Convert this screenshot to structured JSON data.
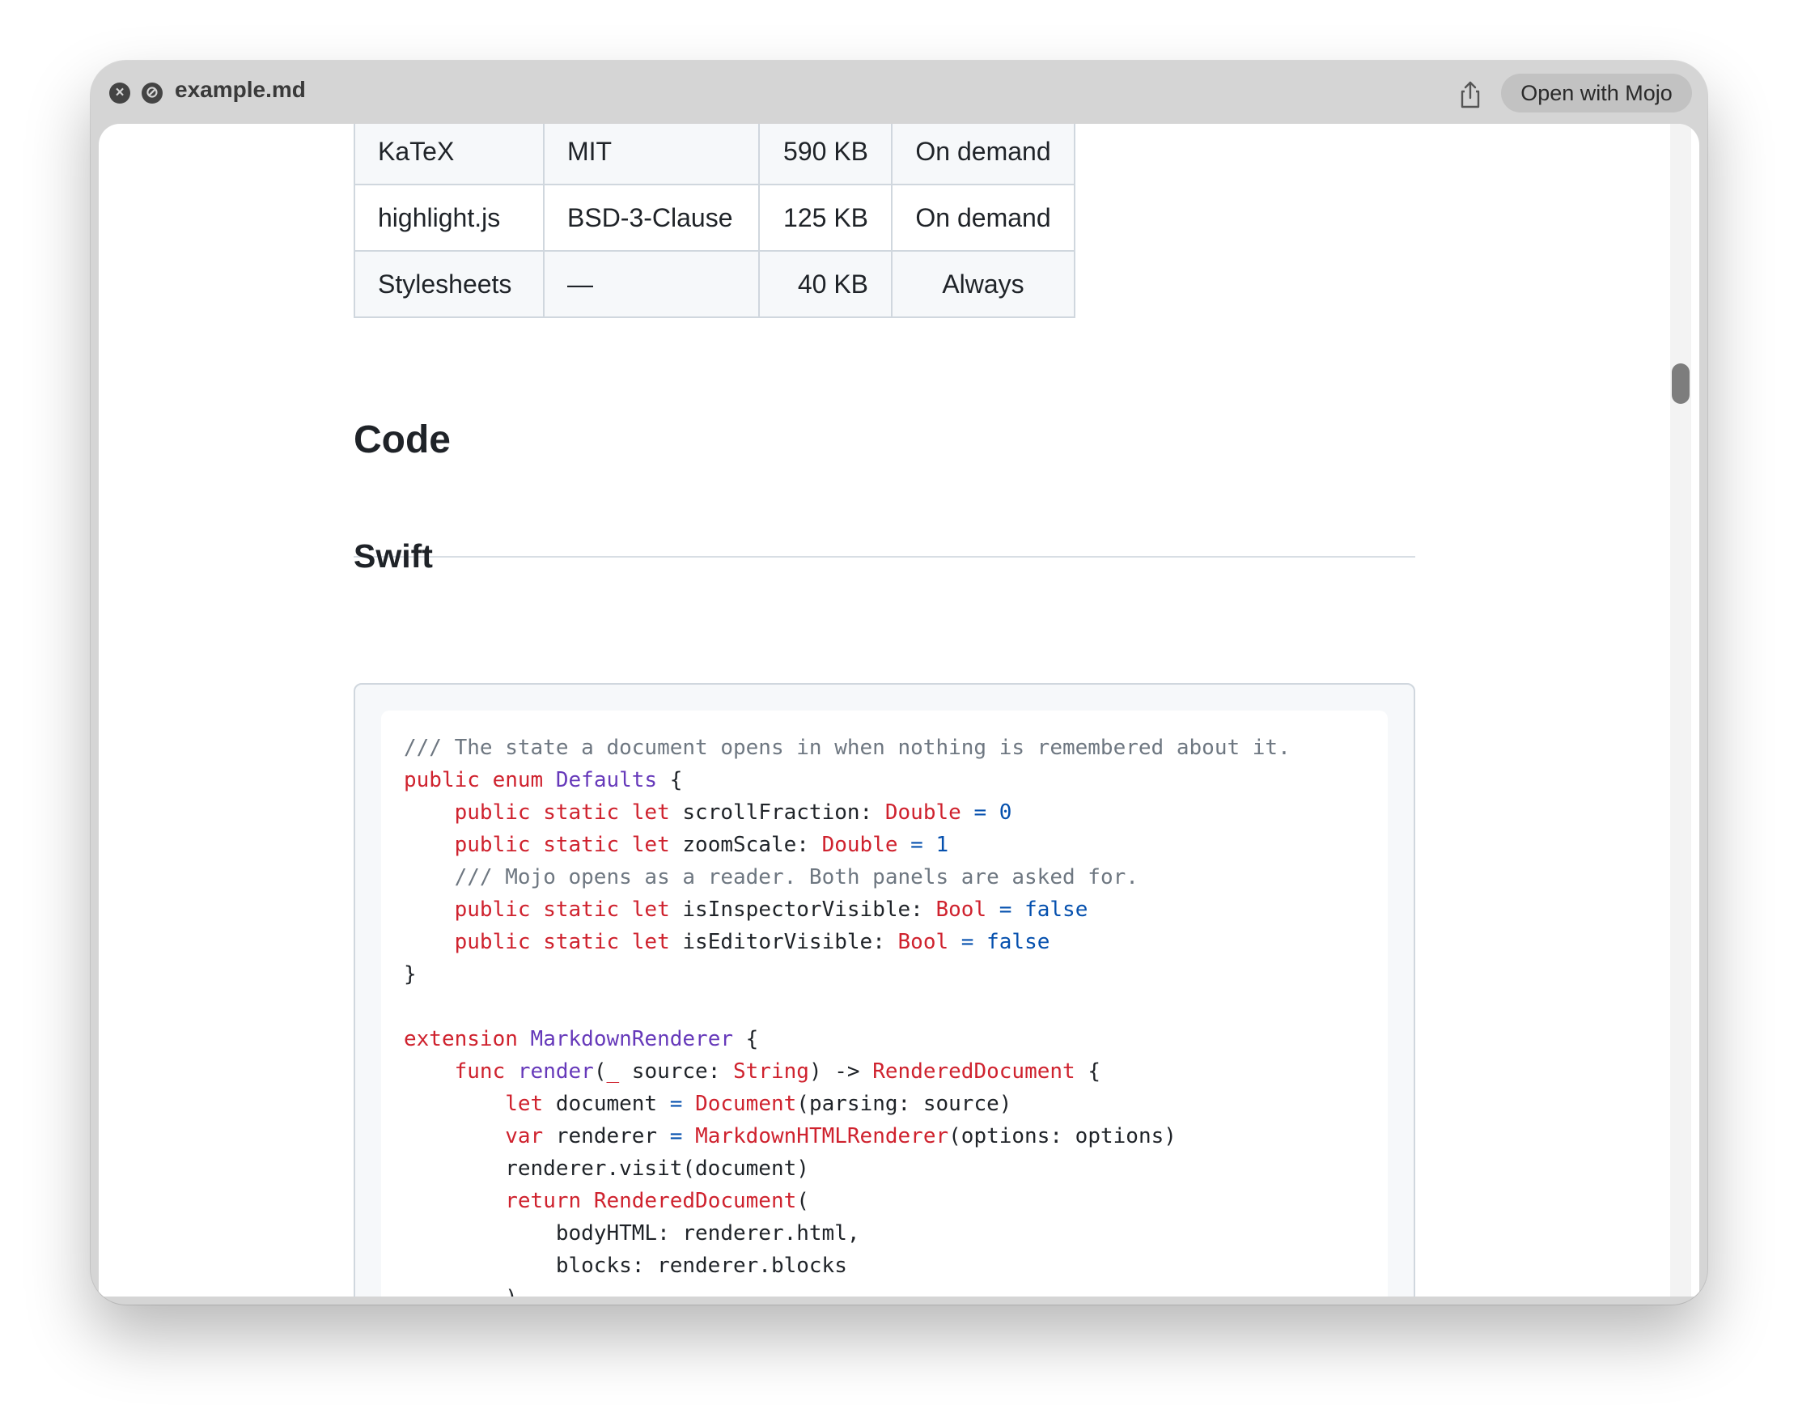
{
  "window": {
    "title": "example.md",
    "open_button_label": "Open with Mojo",
    "close_icon": "x-circle-icon",
    "block_icon": "no-entry-icon",
    "share_icon": "share-icon"
  },
  "table": {
    "rows": [
      {
        "name": "KaTeX",
        "license": "MIT",
        "size": "590 KB",
        "loading": "On demand"
      },
      {
        "name": "highlight.js",
        "license": "BSD-3-Clause",
        "size": "125 KB",
        "loading": "On demand"
      },
      {
        "name": "Stylesheets",
        "license": "—",
        "size": "40 KB",
        "loading": "Always"
      }
    ]
  },
  "headings": {
    "code": "Code",
    "swift": "Swift"
  },
  "code_lines": [
    [
      {
        "t": "/// The state a document opens in when nothing is remembered about it.",
        "c": "cm"
      }
    ],
    [
      {
        "t": "public",
        "c": "kw"
      },
      {
        "t": " ",
        "c": "pl"
      },
      {
        "t": "enum",
        "c": "kw"
      },
      {
        "t": " ",
        "c": "pl"
      },
      {
        "t": "Defaults",
        "c": "ty"
      },
      {
        "t": " {",
        "c": "pl"
      }
    ],
    [
      {
        "t": "    ",
        "c": "pl"
      },
      {
        "t": "public",
        "c": "kw"
      },
      {
        "t": " ",
        "c": "pl"
      },
      {
        "t": "static",
        "c": "kw"
      },
      {
        "t": " ",
        "c": "pl"
      },
      {
        "t": "let",
        "c": "kw"
      },
      {
        "t": " scrollFraction: ",
        "c": "pl"
      },
      {
        "t": "Double",
        "c": "kw"
      },
      {
        "t": " ",
        "c": "pl"
      },
      {
        "t": "=",
        "c": "nu"
      },
      {
        "t": " ",
        "c": "pl"
      },
      {
        "t": "0",
        "c": "nu"
      }
    ],
    [
      {
        "t": "    ",
        "c": "pl"
      },
      {
        "t": "public",
        "c": "kw"
      },
      {
        "t": " ",
        "c": "pl"
      },
      {
        "t": "static",
        "c": "kw"
      },
      {
        "t": " ",
        "c": "pl"
      },
      {
        "t": "let",
        "c": "kw"
      },
      {
        "t": " zoomScale: ",
        "c": "pl"
      },
      {
        "t": "Double",
        "c": "kw"
      },
      {
        "t": " ",
        "c": "pl"
      },
      {
        "t": "=",
        "c": "nu"
      },
      {
        "t": " ",
        "c": "pl"
      },
      {
        "t": "1",
        "c": "nu"
      }
    ],
    [
      {
        "t": "    ",
        "c": "pl"
      },
      {
        "t": "/// Mojo opens as a reader. Both panels are asked for.",
        "c": "cm"
      }
    ],
    [
      {
        "t": "    ",
        "c": "pl"
      },
      {
        "t": "public",
        "c": "kw"
      },
      {
        "t": " ",
        "c": "pl"
      },
      {
        "t": "static",
        "c": "kw"
      },
      {
        "t": " ",
        "c": "pl"
      },
      {
        "t": "let",
        "c": "kw"
      },
      {
        "t": " isInspectorVisible: ",
        "c": "pl"
      },
      {
        "t": "Bool",
        "c": "kw"
      },
      {
        "t": " ",
        "c": "pl"
      },
      {
        "t": "=",
        "c": "nu"
      },
      {
        "t": " ",
        "c": "pl"
      },
      {
        "t": "false",
        "c": "nu"
      }
    ],
    [
      {
        "t": "    ",
        "c": "pl"
      },
      {
        "t": "public",
        "c": "kw"
      },
      {
        "t": " ",
        "c": "pl"
      },
      {
        "t": "static",
        "c": "kw"
      },
      {
        "t": " ",
        "c": "pl"
      },
      {
        "t": "let",
        "c": "kw"
      },
      {
        "t": " isEditorVisible: ",
        "c": "pl"
      },
      {
        "t": "Bool",
        "c": "kw"
      },
      {
        "t": " ",
        "c": "pl"
      },
      {
        "t": "=",
        "c": "nu"
      },
      {
        "t": " ",
        "c": "pl"
      },
      {
        "t": "false",
        "c": "nu"
      }
    ],
    [
      {
        "t": "}",
        "c": "pl"
      }
    ],
    [
      {
        "t": "",
        "c": "pl"
      }
    ],
    [
      {
        "t": "extension",
        "c": "kw"
      },
      {
        "t": " ",
        "c": "pl"
      },
      {
        "t": "MarkdownRenderer",
        "c": "ty"
      },
      {
        "t": " {",
        "c": "pl"
      }
    ],
    [
      {
        "t": "    ",
        "c": "pl"
      },
      {
        "t": "func",
        "c": "kw"
      },
      {
        "t": " ",
        "c": "pl"
      },
      {
        "t": "render",
        "c": "ty"
      },
      {
        "t": "(",
        "c": "pl"
      },
      {
        "t": "_",
        "c": "kw"
      },
      {
        "t": " source: ",
        "c": "pl"
      },
      {
        "t": "String",
        "c": "kw"
      },
      {
        "t": ") -> ",
        "c": "pl"
      },
      {
        "t": "RenderedDocument",
        "c": "kw"
      },
      {
        "t": " {",
        "c": "pl"
      }
    ],
    [
      {
        "t": "        ",
        "c": "pl"
      },
      {
        "t": "let",
        "c": "kw"
      },
      {
        "t": " document ",
        "c": "pl"
      },
      {
        "t": "=",
        "c": "nu"
      },
      {
        "t": " ",
        "c": "pl"
      },
      {
        "t": "Document",
        "c": "kw"
      },
      {
        "t": "(parsing: source)",
        "c": "pl"
      }
    ],
    [
      {
        "t": "        ",
        "c": "pl"
      },
      {
        "t": "var",
        "c": "kw"
      },
      {
        "t": " renderer ",
        "c": "pl"
      },
      {
        "t": "=",
        "c": "nu"
      },
      {
        "t": " ",
        "c": "pl"
      },
      {
        "t": "MarkdownHTMLRenderer",
        "c": "kw"
      },
      {
        "t": "(options: options)",
        "c": "pl"
      }
    ],
    [
      {
        "t": "        renderer.visit(document)",
        "c": "pl"
      }
    ],
    [
      {
        "t": "        ",
        "c": "pl"
      },
      {
        "t": "return",
        "c": "kw"
      },
      {
        "t": " ",
        "c": "pl"
      },
      {
        "t": "RenderedDocument",
        "c": "kw"
      },
      {
        "t": "(",
        "c": "pl"
      }
    ],
    [
      {
        "t": "            bodyHTML: renderer.html,",
        "c": "pl"
      }
    ],
    [
      {
        "t": "            blocks: renderer.blocks",
        "c": "pl"
      }
    ],
    [
      {
        "t": "        )",
        "c": "pl"
      }
    ],
    [
      {
        "t": "    }",
        "c": "pl"
      }
    ],
    [
      {
        "t": "}",
        "c": "pl"
      }
    ]
  ]
}
